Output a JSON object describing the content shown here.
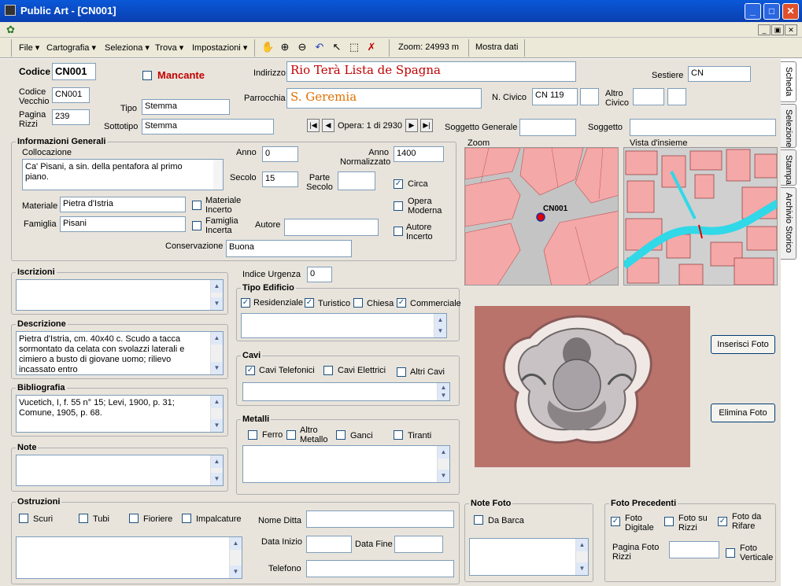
{
  "window": {
    "title": "Public Art - [CN001]"
  },
  "menu": {
    "items": [
      "File",
      "Cartografia",
      "Seleziona",
      "Trova",
      "Impostazioni"
    ],
    "zoom": "Zoom: 24993 m",
    "show_data": "Mostra dati"
  },
  "header": {
    "codice_label": "Codice",
    "codice": "CN001",
    "mancante_label": "Mancante",
    "codice_vecchio_label": "Codice Vecchio",
    "codice_vecchio": "CN001",
    "pagina_rizzi_label": "Pagina Rizzi",
    "pagina_rizzi": "239",
    "tipo_label": "Tipo",
    "tipo": "Stemma",
    "sottotipo_label": "Sottotipo",
    "sottotipo": "Stemma",
    "indirizzo_label": "Indirizzo",
    "indirizzo": "Rio Terà Lista de Spagna",
    "parrocchia_label": "Parrocchia",
    "parrocchia": "S. Geremia",
    "sestiere_label": "Sestiere",
    "sestiere": "CN",
    "ncivico_label": "N. Civico",
    "ncivico": "CN 119",
    "altro_civico_label": "Altro Civico",
    "opera_label": "Opera: 1 di 2930",
    "soggetto_generale_label": "Soggetto Generale",
    "soggetto_label": "Soggetto"
  },
  "info": {
    "title": "Informazioni Generali",
    "collocazione_label": "Collocazione",
    "collocazione": "Ca' Pisani, a sin. della pentafora al primo piano.",
    "anno_label": "Anno",
    "anno": "0",
    "anno_norm_label": "Anno Normalizzato",
    "anno_norm": "1400",
    "secolo_label": "Secolo",
    "secolo": "15",
    "parte_secolo_label": "Parte Secolo",
    "circa_label": "Circa",
    "materiale_label": "Materiale",
    "materiale": "Pietra d'Istria",
    "materiale_incerto_label": "Materiale Incerto",
    "opera_moderna_label": "Opera Moderna",
    "famiglia_label": "Famiglia",
    "famiglia": "Pisani",
    "famiglia_incerta_label": "Famiglia Incerta",
    "autore_label": "Autore",
    "autore_incerto_label": "Autore Incerto",
    "conservazione_label": "Conservazione",
    "conservazione": "Buona"
  },
  "maps": {
    "zoom_title": "Zoom",
    "overview_title": "Vista d'insieme",
    "marker_label": "CN001"
  },
  "tabs": [
    "Scheda",
    "Selezione",
    "Stampa",
    "Archivio Storico"
  ],
  "iscrizioni": {
    "title": "Iscrizioni"
  },
  "descrizione": {
    "title": "Descrizione",
    "text": "Pietra d'Istria, cm. 40x40 c.  Scudo a tacca sormontato da celata con svolazzi laterali e cimiero a busto di giovane uomo; rilievo incassato entro"
  },
  "bibliografia": {
    "title": "Bibliografia",
    "text": "Vucetich, I, f. 55 n° 15; Levi, 1900, p. 31; Comune, 1905, p. 68."
  },
  "note": {
    "title": "Note"
  },
  "urgenza": {
    "label": "Indice Urgenza",
    "value": "0"
  },
  "tipo_edificio": {
    "title": "Tipo Edificio",
    "residenziale": "Residenziale",
    "turistico": "Turistico",
    "chiesa": "Chiesa",
    "commerciale": "Commerciale"
  },
  "cavi": {
    "title": "Cavi",
    "telefonici": "Cavi Telefonici",
    "elettrici": "Cavi Elettrici",
    "altri": "Altri Cavi"
  },
  "metalli": {
    "title": "Metalli",
    "ferro": "Ferro",
    "altro": "Altro Metallo",
    "ganci": "Ganci",
    "tiranti": "Tiranti"
  },
  "photo": {
    "insert": "Inserisci Foto",
    "delete": "Elimina Foto"
  },
  "ostruzioni": {
    "title": "Ostruzioni",
    "scuri": "Scuri",
    "tubi": "Tubi",
    "fioriere": "Fioriere",
    "impalcature": "Impalcature",
    "nome_ditta": "Nome Ditta",
    "data_inizio": "Data Inizio",
    "data_fine": "Data Fine",
    "telefono": "Telefono"
  },
  "note_foto": {
    "title": "Note Foto",
    "da_barca": "Da Barca"
  },
  "foto_prec": {
    "title": "Foto Precedenti",
    "digitale": "Foto Digitale",
    "su_rizzi": "Foto su Rizzi",
    "da_rifare": "Foto da Rifare",
    "pagina": "Pagina Foto Rizzi",
    "verticale": "Foto Verticale"
  },
  "colors": {
    "titlebar": "#0a4fc8",
    "accent_red": "#c00000",
    "accent_orange": "#e07000"
  }
}
